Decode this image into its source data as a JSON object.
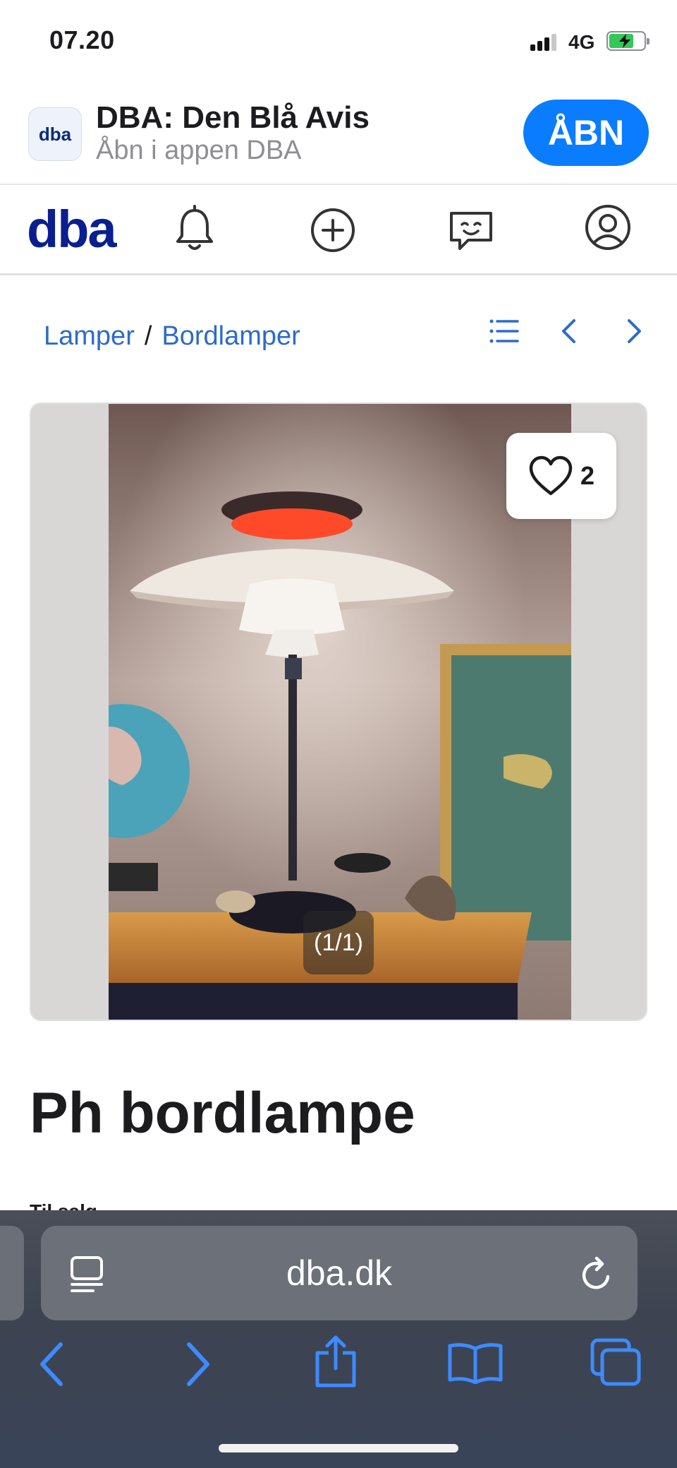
{
  "status_bar": {
    "time": "07.20",
    "network": "4G"
  },
  "app_banner": {
    "icon_text": "dba",
    "title": "DBA: Den Blå Avis",
    "subtitle": "Åbn i appen DBA",
    "open_label": "ÅBN"
  },
  "header": {
    "logo": "dba",
    "icons": [
      "bell-icon",
      "plus-circle-icon",
      "chat-smile-icon",
      "profile-icon"
    ]
  },
  "breadcrumb": {
    "items": [
      "Lamper",
      "Bordlamper"
    ],
    "separator": "/"
  },
  "gallery": {
    "favorite_count": "2",
    "image_counter": "(1/1)"
  },
  "listing": {
    "title": "Ph bordlampe",
    "status": "Til salg"
  },
  "safari": {
    "url": "dba.dk",
    "toolbar_icons": [
      "back-icon",
      "forward-icon",
      "share-icon",
      "bookmarks-icon",
      "tabs-icon"
    ]
  },
  "colors": {
    "brand": "#0a1f8f",
    "link": "#2d6bc9",
    "open_button": "#0a7cff",
    "safari_icons": "#3d8bff"
  }
}
